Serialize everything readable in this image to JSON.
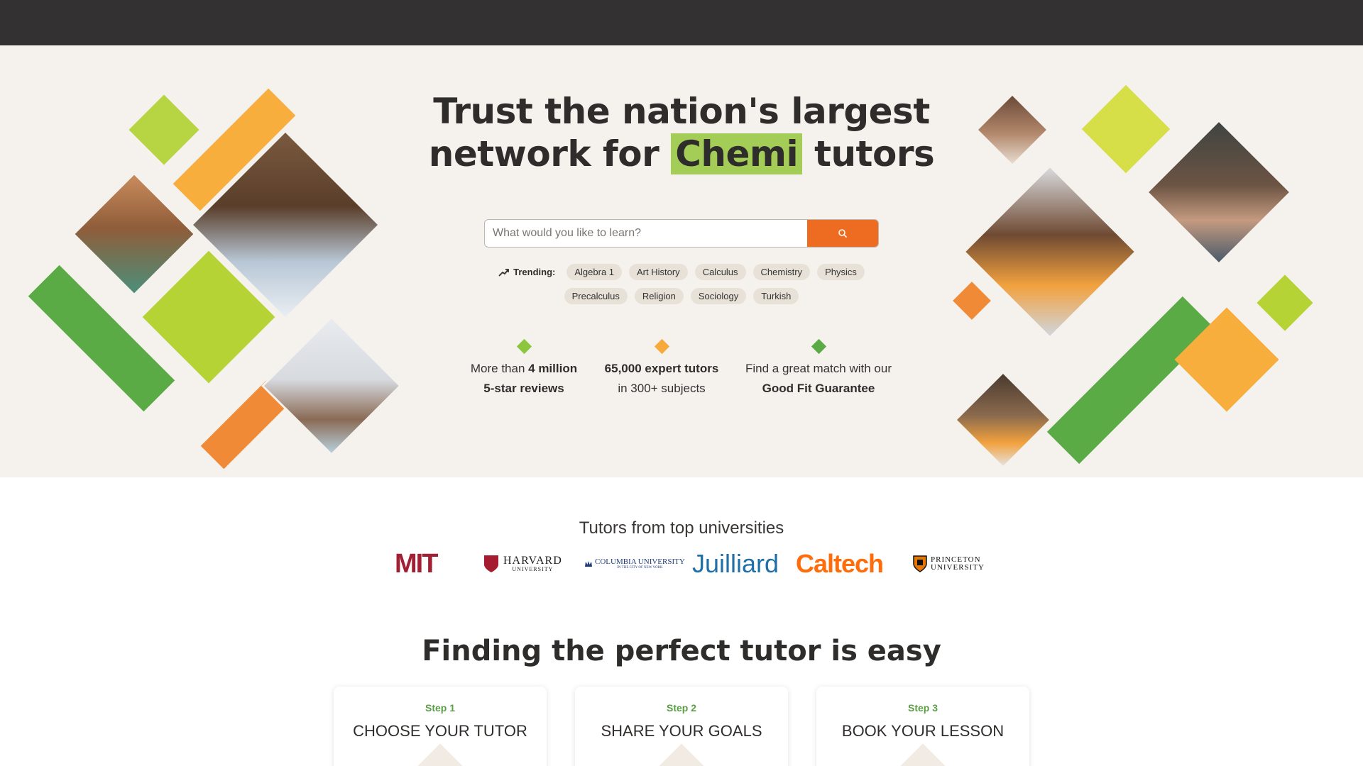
{
  "hero": {
    "headline_line1": "Trust the nation's largest",
    "headline_pre": "network for ",
    "headline_highlight": "Chemi",
    "headline_post": " tutors",
    "search": {
      "placeholder": "What would you like to learn?",
      "button_icon": "search-icon"
    },
    "trending": {
      "label": "Trending:",
      "icon": "trending-up-icon",
      "row1": [
        "Algebra 1",
        "Art History",
        "Calculus",
        "Chemistry",
        "Physics"
      ],
      "row2": [
        "Precalculus",
        "Religion",
        "Sociology",
        "Turkish"
      ]
    },
    "stats": [
      {
        "pre": "More than ",
        "bold": "4 million",
        "line2": "5-star reviews",
        "line2_bold": true,
        "color": "#8cc63f"
      },
      {
        "pre": "",
        "bold": "65,000 expert tutors",
        "line2": "in 300+ subjects",
        "line2_bold": false,
        "color": "#f7a93b"
      },
      {
        "pre": "Find a great match with our",
        "bold": "",
        "line2": "Good Fit Guarantee",
        "line2_bold": true,
        "color": "#5aaa45"
      }
    ]
  },
  "universities": {
    "title": "Tutors from top universities",
    "logos": [
      "MIT",
      "HARVARD",
      "UNIVERSITY",
      "COLUMBIA UNIVERSITY",
      "IN THE CITY OF NEW YORK",
      "Juilliard",
      "Caltech",
      "PRINCETON",
      "UNIVERSITY"
    ]
  },
  "steps": {
    "title": "Finding the perfect tutor is easy",
    "items": [
      {
        "step": "Step 1",
        "title": "CHOOSE YOUR TUTOR"
      },
      {
        "step": "Step 2",
        "title": "SHARE YOUR GOALS"
      },
      {
        "step": "Step 3",
        "title": "BOOK YOUR LESSON"
      }
    ]
  },
  "colors": {
    "topbar": "#333131",
    "hero_bg": "#f5f1ec",
    "accent_orange": "#ee6c22",
    "highlight_green": "#a3cd56",
    "step_green": "#5b9e45"
  }
}
